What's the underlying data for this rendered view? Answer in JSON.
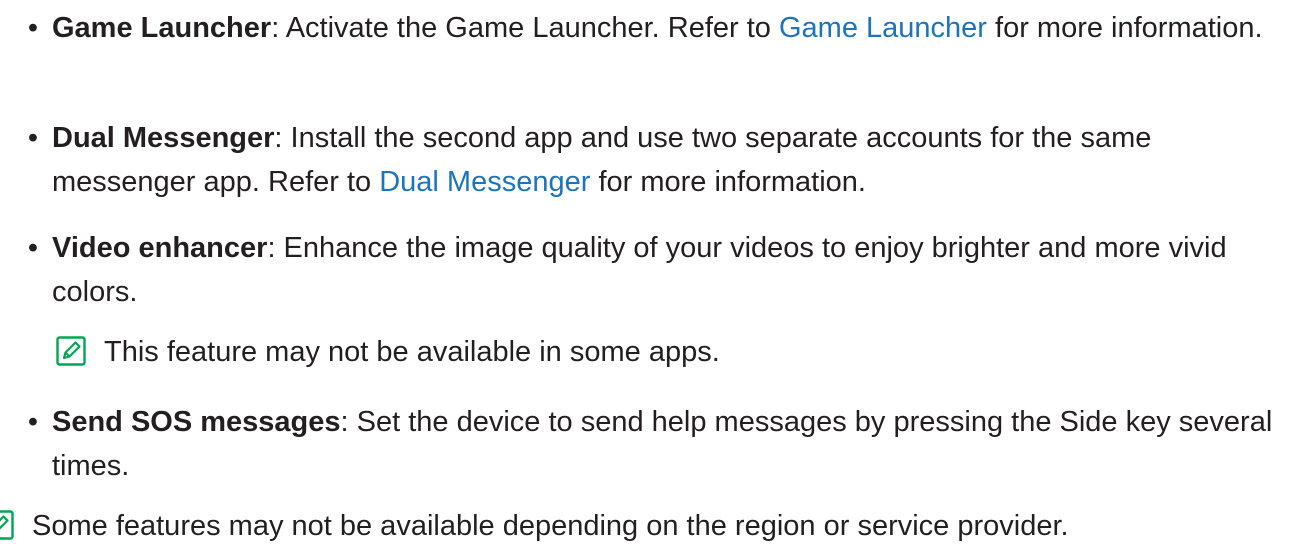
{
  "items": [
    {
      "bullet": "•",
      "term": "Game Launcher",
      "desc_before": ": Activate the Game Launcher. Refer to ",
      "link": "Game Launcher",
      "desc_after": " for more information."
    },
    {
      "bullet": "•",
      "term": "Dual Messenger",
      "desc_before": ": Install the second app and use two separate accounts for the same messenger app. Refer to ",
      "link": "Dual Messenger",
      "desc_after": " for more information."
    },
    {
      "bullet": "•",
      "term": "Video enhancer",
      "desc_before": ": Enhance the image quality of your videos to enjoy brighter and more vivid colors."
    },
    {
      "bullet": "•",
      "term": "Send SOS messages",
      "desc_before": ": Set the device to send help messages by pressing the Side key several times."
    }
  ],
  "notes": [
    {
      "icon": "note-pencil-icon",
      "text": "This feature may not be available in some apps."
    },
    {
      "icon": "note-pencil-icon",
      "text": "Some features may not be available depending on the region or service provider."
    }
  ],
  "colors": {
    "text": "#231f20",
    "link": "#1c75bc",
    "note_icon": "#00a651"
  }
}
